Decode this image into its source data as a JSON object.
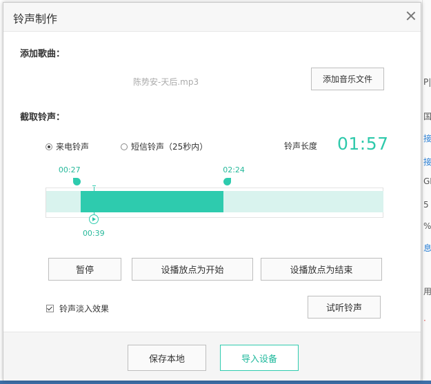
{
  "background": {
    "fragments": [
      {
        "text": "P|",
        "color": "#555555"
      },
      {
        "text": "国",
        "color": "#555555"
      },
      {
        "text": "接",
        "color": "#2a7fd4"
      },
      {
        "text": "接",
        "color": "#2a7fd4"
      },
      {
        "text": "GE",
        "color": "#555555"
      },
      {
        "text": "5",
        "color": "#555555"
      },
      {
        "text": "%",
        "color": "#555555"
      },
      {
        "text": "息",
        "color": "#2a7fd4"
      },
      {
        "text": "用",
        "color": "#555555"
      },
      {
        "text": "·",
        "color": "#e05050"
      }
    ]
  },
  "dialog": {
    "title": "铃声制作",
    "close_icon": "close-icon"
  },
  "add_song": {
    "label": "添加歌曲：",
    "file_name": "陈势安-天后.mp3",
    "add_button_label": "添加音乐文件"
  },
  "clip": {
    "label": "截取铃声：",
    "options": [
      {
        "label": "来电铃声",
        "checked": true
      },
      {
        "label": "短信铃声（25秒内）",
        "checked": false
      }
    ],
    "length_label": "铃声长度",
    "length_value": "01:57"
  },
  "timeline": {
    "start_label": "00:27",
    "end_label": "02:24",
    "playhead_label": "00:39",
    "start_fraction": 0.102,
    "end_fraction": 0.526,
    "playhead_fraction": 0.141,
    "track_color": "#d9f3ee",
    "selection_color": "#2ecbae"
  },
  "controls": {
    "pause_label": "暂停",
    "set_start_label": "设播放点为开始",
    "set_end_label": "设播放点为结束",
    "fade_label": "铃声淡入效果",
    "fade_checked": true,
    "preview_label": "试听铃声"
  },
  "footer": {
    "save_label": "保存本地",
    "import_label": "导入设备"
  },
  "colors": {
    "accent": "#2ecbae"
  }
}
